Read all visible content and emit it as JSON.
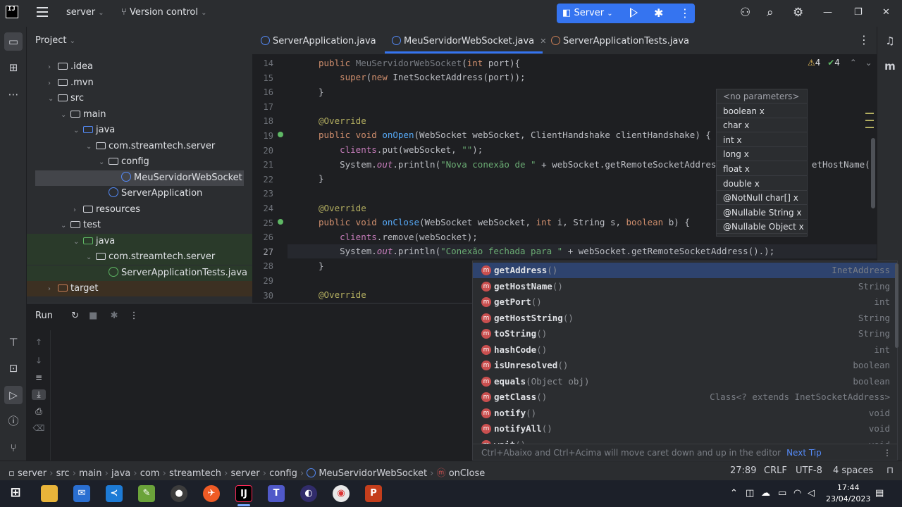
{
  "titlebar": {
    "project": "server",
    "version_control": "Version control",
    "run_config": "Server"
  },
  "project_panel": {
    "title": "Project",
    "tree": [
      {
        "label": ".idea",
        "depth": 1,
        "kind": "folder",
        "chev": "›"
      },
      {
        "label": ".mvn",
        "depth": 1,
        "kind": "folder",
        "chev": "›"
      },
      {
        "label": "src",
        "depth": 1,
        "kind": "folder",
        "chev": "⌄"
      },
      {
        "label": "main",
        "depth": 2,
        "kind": "folder",
        "chev": "⌄"
      },
      {
        "label": "java",
        "depth": 3,
        "kind": "folder-blue",
        "chev": "⌄"
      },
      {
        "label": "com.streamtech.server",
        "depth": 4,
        "kind": "package",
        "chev": "⌄"
      },
      {
        "label": "config",
        "depth": 5,
        "kind": "folder",
        "chev": "⌄"
      },
      {
        "label": "MeuServidorWebSocket",
        "depth": 6,
        "kind": "class",
        "chev": "",
        "selected": true
      },
      {
        "label": "ServerApplication",
        "depth": 5,
        "kind": "class",
        "chev": ""
      },
      {
        "label": "resources",
        "depth": 3,
        "kind": "folder",
        "chev": "›"
      },
      {
        "label": "test",
        "depth": 2,
        "kind": "folder",
        "chev": "⌄"
      },
      {
        "label": "java",
        "depth": 3,
        "kind": "folder-green",
        "chev": "⌄",
        "bg": "green"
      },
      {
        "label": "com.streamtech.server",
        "depth": 4,
        "kind": "package",
        "chev": "⌄",
        "bg": "green"
      },
      {
        "label": "ServerApplicationTests.java",
        "depth": 5,
        "kind": "class-green",
        "chev": "",
        "bg": "green"
      },
      {
        "label": "target",
        "depth": 1,
        "kind": "folder-orange",
        "chev": "›",
        "bg": "brown"
      }
    ]
  },
  "tabs": [
    {
      "label": "ServerApplication.java"
    },
    {
      "label": "MeuServidorWebSocket.java",
      "active": true
    },
    {
      "label": "ServerApplicationTests.java"
    }
  ],
  "inspections": {
    "warnings": "4",
    "ok": "4"
  },
  "editor": {
    "line_numbers": [
      "14",
      "15",
      "16",
      "17",
      "18",
      "19",
      "20",
      "21",
      "22",
      "23",
      "24",
      "25",
      "26",
      "27",
      "28",
      "29",
      "30"
    ],
    "current_line": "27"
  },
  "param_hints": [
    "<no parameters>",
    "boolean x",
    "char x",
    "int x",
    "long x",
    "float x",
    "double x",
    "@NotNull char[] x",
    "@Nullable String x",
    "@Nullable Object x"
  ],
  "completion": {
    "items": [
      {
        "name": "getAddress",
        "params": "()",
        "type": "InetAddress",
        "selected": true
      },
      {
        "name": "getHostName",
        "params": "()",
        "type": "String"
      },
      {
        "name": "getPort",
        "params": "()",
        "type": "int"
      },
      {
        "name": "getHostString",
        "params": "()",
        "type": "String"
      },
      {
        "name": "toString",
        "params": "()",
        "type": "String"
      },
      {
        "name": "hashCode",
        "params": "()",
        "type": "int"
      },
      {
        "name": "isUnresolved",
        "params": "()",
        "type": "boolean"
      },
      {
        "name": "equals",
        "params": "(Object obj)",
        "type": "boolean"
      },
      {
        "name": "getClass",
        "params": "()",
        "type": "Class<? extends InetSocketAddress>"
      },
      {
        "name": "notify",
        "params": "()",
        "type": "void"
      },
      {
        "name": "notifyAll",
        "params": "()",
        "type": "void"
      },
      {
        "name": "wait",
        "params": "()",
        "type": "void"
      }
    ],
    "footer": "Ctrl+Abaixo and Ctrl+Acima will move caret down and up in the editor",
    "next_tip": "Next Tip"
  },
  "run_panel": {
    "title": "Run"
  },
  "statusbar": {
    "breadcrumb": [
      "server",
      "src",
      "main",
      "java",
      "com",
      "streamtech",
      "server",
      "config",
      "MeuServidorWebSocket",
      "onClose"
    ],
    "position": "27:89",
    "line_sep": "CRLF",
    "encoding": "UTF-8",
    "indent": "4 spaces"
  },
  "taskbar": {
    "time": "17:44",
    "date": "23/04/2023"
  }
}
